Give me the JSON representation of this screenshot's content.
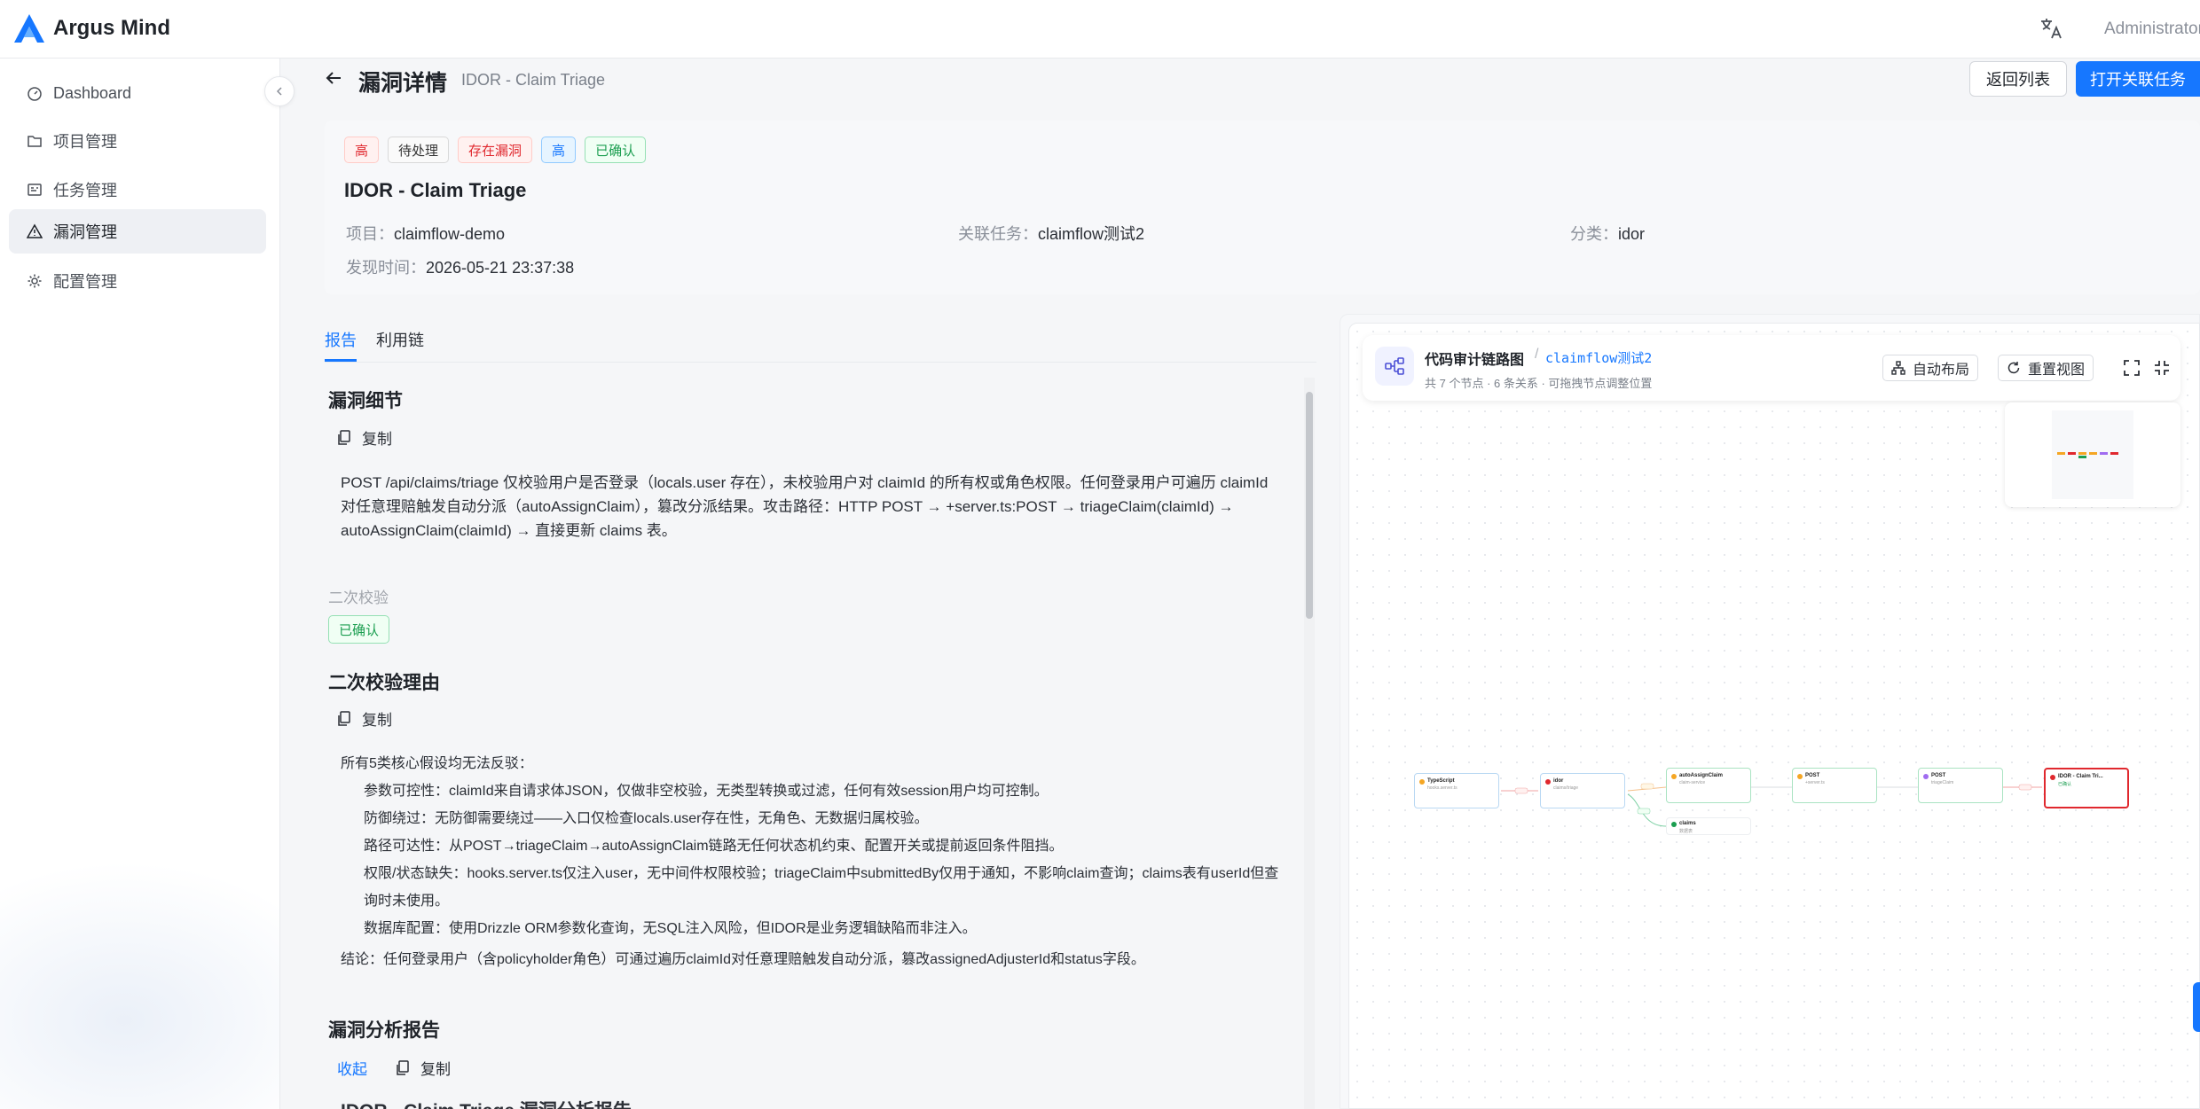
{
  "app": {
    "brand": "Argus Mind",
    "user": "Administrator"
  },
  "sidebar": {
    "items": [
      {
        "label": "Dashboard"
      },
      {
        "label": "项目管理"
      },
      {
        "label": "任务管理"
      },
      {
        "label": "漏洞管理",
        "active": true
      },
      {
        "label": "配置管理"
      }
    ]
  },
  "header": {
    "title": "漏洞详情",
    "subtitle": "IDOR - Claim Triage",
    "back_list_label": "返回列表",
    "open_task_label": "打开关联任务"
  },
  "vuln": {
    "tags": [
      {
        "text": "高",
        "style": "red"
      },
      {
        "text": "待处理",
        "style": "gray"
      },
      {
        "text": "存在漏洞",
        "style": "red"
      },
      {
        "text": "高",
        "style": "blue"
      },
      {
        "text": "已确认",
        "style": "green"
      }
    ],
    "name": "IDOR - Claim Triage",
    "project_label": "项目：",
    "project": "claimflow-demo",
    "task_label": "关联任务：",
    "task": "claimflow测试2",
    "category_label": "分类：",
    "category": "idor",
    "found_label": "发现时间：",
    "found_time": "2026-05-21 23:37:38"
  },
  "tabs": [
    {
      "label": "报告",
      "active": true
    },
    {
      "label": "利用链"
    }
  ],
  "report": {
    "details_title": "漏洞细节",
    "copy_label": "复制",
    "details_text": "POST /api/claims/triage 仅校验用户是否登录（locals.user 存在），未校验用户对 claimId 的所有权或角色权限。任何登录用户可遍历 claimId 对任意理赔触发自动分派（autoAssignClaim），篡改分派结果。攻击路径：HTTP POST → +server.ts:POST → triageClaim(claimId) → autoAssignClaim(claimId) → 直接更新 claims 表。",
    "recheck_label": "二次校验",
    "recheck_status": "已确认",
    "reason_title": "二次校验理由",
    "reason_intro": "所有5类核心假设均无法反驳：",
    "reason_items": [
      "参数可控性：claimId来自请求体JSON，仅做非空校验，无类型转换或过滤，任何有效session用户均可控制。",
      "防御绕过：无防御需要绕过——入口仅检查locals.user存在性，无角色、无数据归属校验。",
      "路径可达性：从POST→triageClaim→autoAssignClaim链路无任何状态机约束、配置开关或提前返回条件阻挡。",
      "权限/状态缺失：hooks.server.ts仅注入user，无中间件权限校验；triageClaim中submittedBy仅用于通知，不影响claim查询；claims表有userId但查询时未使用。",
      "数据库配置：使用Drizzle ORM参数化查询，无SQL注入风险，但IDOR是业务逻辑缺陷而非注入。"
    ],
    "reason_conclusion": "结论：任何登录用户（含policyholder角色）可通过遍历claimId对任意理赔触发自动分派，篡改assignedAdjusterId和status字段。",
    "analysis_title": "漏洞分析报告",
    "collapse_label": "收起",
    "analysis_preview": "IDOR - Claim Triage 漏洞分析报告"
  },
  "graph": {
    "title": "代码审计链路图",
    "separator": "/",
    "task": "claimflow测试2",
    "meta": "共 7 个节点 · 6 条关系 · 可拖拽节点调整位置",
    "auto_layout_label": "自动布局",
    "reset_view_label": "重置视图",
    "nodes": [
      {
        "title": "TypeScript",
        "sub": "hooks.server.ts",
        "color": "#f5a623"
      },
      {
        "title": "idor",
        "sub": "claims/triage",
        "color": "#e0282e"
      },
      {
        "title": "autoAssignClaim",
        "sub": "claim-service",
        "color": "#f5a623"
      },
      {
        "title": "POST",
        "sub": "+server.ts",
        "color": "#f5a623"
      },
      {
        "title": "POST",
        "sub": "triageClaim",
        "color": "#a06cf0"
      },
      {
        "title": "IDOR - Claim Tri...",
        "sub": "已确认",
        "color": "#e0282e"
      },
      {
        "title": "claims",
        "sub": "数据表",
        "color": "#1b9e50"
      }
    ]
  },
  "colors": {
    "accent": "#1677ff",
    "danger": "#e0282e",
    "success": "#1b9e50"
  }
}
